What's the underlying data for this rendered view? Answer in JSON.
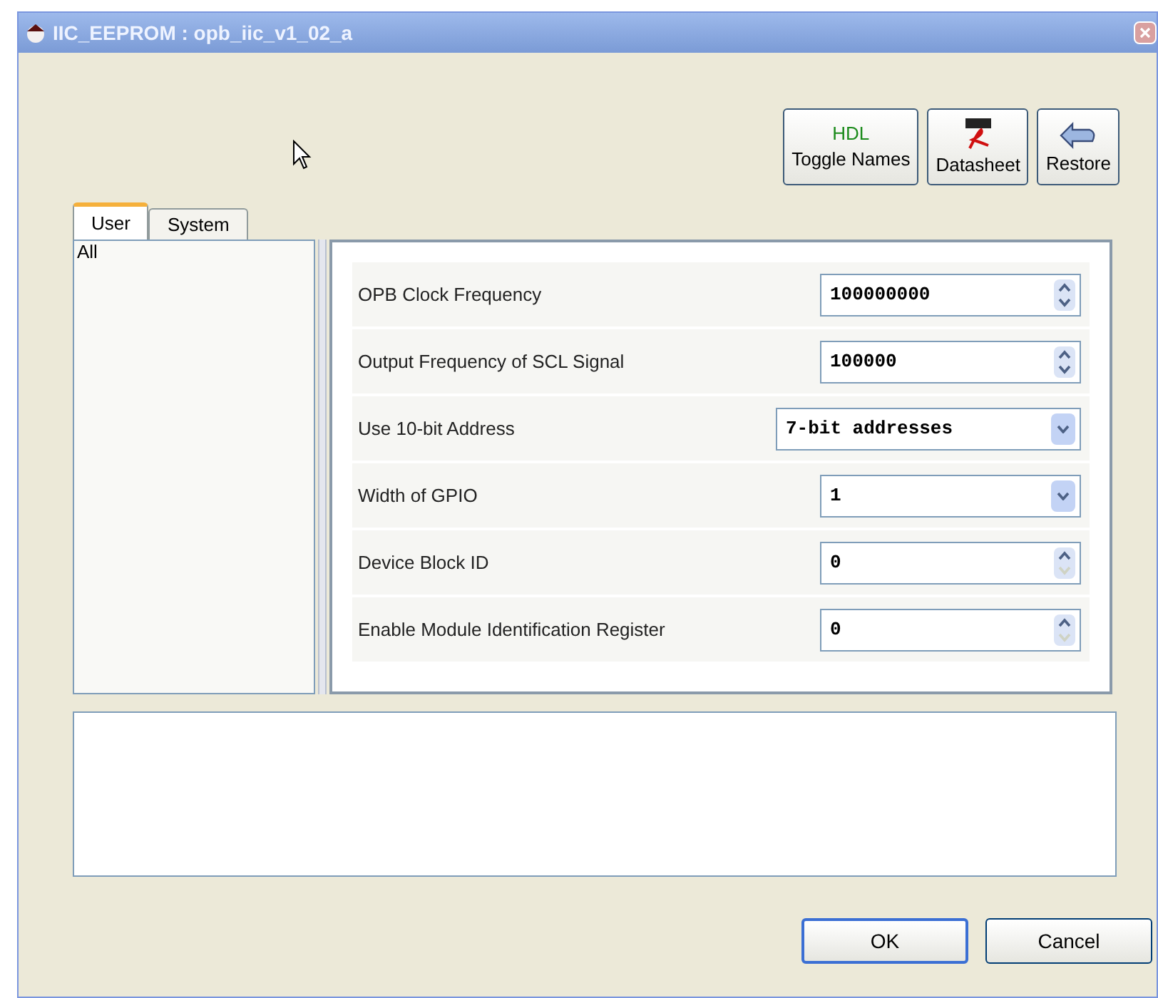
{
  "window": {
    "title": "IIC_EEPROM : opb_iic_v1_02_a"
  },
  "toolbar": [
    {
      "kind": "hdl",
      "icon_text": "HDL",
      "label": "Toggle Names"
    },
    {
      "kind": "pdf",
      "label": "Datasheet"
    },
    {
      "kind": "restore",
      "label": "Restore"
    }
  ],
  "tabs": [
    {
      "label": "User",
      "selected": true
    },
    {
      "label": "System",
      "selected": false
    }
  ],
  "categories": [
    {
      "label": "All"
    }
  ],
  "parameters": [
    {
      "label": "OPB Clock Frequency",
      "kind": "spinner",
      "value": "100000000",
      "down_enabled": true
    },
    {
      "label": "Output Frequency of SCL Signal",
      "kind": "spinner",
      "value": "100000",
      "down_enabled": true
    },
    {
      "label": "Use 10-bit Address",
      "kind": "dropdown",
      "wide": true,
      "value": "7-bit addresses"
    },
    {
      "label": "Width of GPIO",
      "kind": "dropdown",
      "wide": false,
      "value": "1"
    },
    {
      "label": "Device Block ID",
      "kind": "spinner",
      "value": "0",
      "down_enabled": false
    },
    {
      "label": "Enable Module Identification Register",
      "kind": "spinner",
      "value": "0",
      "down_enabled": false
    }
  ],
  "buttons": [
    {
      "label": "OK",
      "default": true
    },
    {
      "label": "Cancel",
      "default": false
    }
  ]
}
